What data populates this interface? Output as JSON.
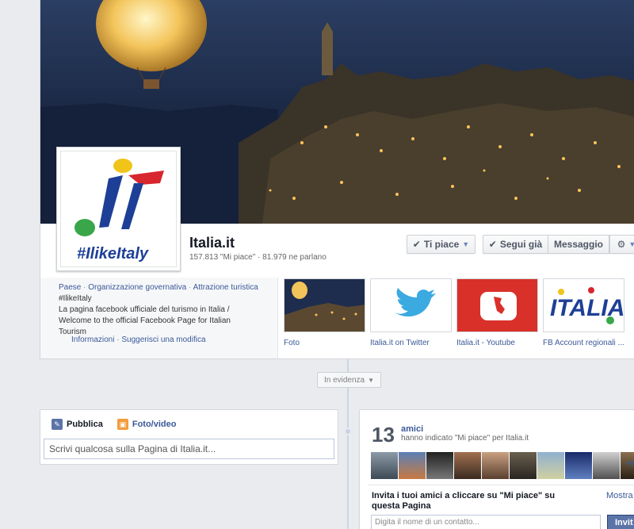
{
  "page": {
    "title": "Italia.it",
    "stats": "157.813 \"Mi piace\" · 81.979 ne parlano",
    "logo_text": "#IlikeItaly"
  },
  "actions": {
    "like": "Ti piace",
    "follow": "Segui già",
    "message": "Messaggio",
    "gear": "⚙"
  },
  "about": {
    "categories": [
      "Paese",
      "Organizzazione governativa",
      "Attrazione turistica"
    ],
    "hashtag": "#IlikeItaly",
    "description": "La pagina facebook ufficiale del turismo in Italia / Welcome to the official Facebook Page for Italian Tourism",
    "info_link": "Informazioni",
    "suggest_link": "Suggerisci una modifica"
  },
  "apps": [
    {
      "label": "Foto",
      "icon": "photo-thumbnail"
    },
    {
      "label": "Italia.it on Twitter",
      "icon": "twitter-bird-icon"
    },
    {
      "label": "Italia.it - Youtube",
      "icon": "youtube-italy-icon"
    },
    {
      "label": "FB Account regionali ...",
      "icon": "italia-logo-icon"
    }
  ],
  "timeline": {
    "highlight": "In evidenza"
  },
  "composer": {
    "tab_post": "Pubblica",
    "tab_photo": "Foto/video",
    "placeholder": "Scrivi qualcosa sulla Pagina di Italia.it..."
  },
  "friends": {
    "count": "13",
    "label": "amici",
    "sub": "hanno indicato \"Mi piace\" per Italia.it",
    "more": "+/",
    "invite_text": "Invita i tuoi amici a cliccare su \"Mi piace\" su questa Pagina",
    "show_all": "Mostra t",
    "contact_placeholder": "Digita il nome di un contatto...",
    "invite_button": "Invit"
  },
  "colors": {
    "link": "#3b5998",
    "background": "#e9ebee"
  }
}
